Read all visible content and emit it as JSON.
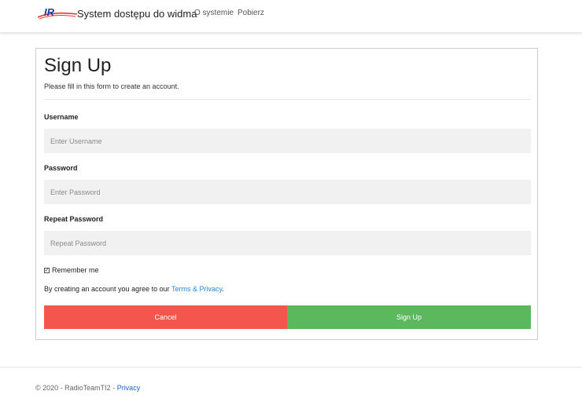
{
  "header": {
    "logo_text": "IR",
    "brand": "System dostępu do widma",
    "nav": [
      {
        "label": "O systemie"
      },
      {
        "label": "Pobierz"
      }
    ]
  },
  "form": {
    "title": "Sign Up",
    "subtitle": "Please fill in this form to create an account.",
    "username": {
      "label": "Username",
      "placeholder": "Enter Username",
      "value": ""
    },
    "password": {
      "label": "Password",
      "placeholder": "Enter Password",
      "value": ""
    },
    "repeat_password": {
      "label": "Repeat Password",
      "placeholder": "Repeat Password",
      "value": ""
    },
    "remember": {
      "label": "Remember me",
      "checked": true
    },
    "terms_prefix": "By creating an account you agree to our ",
    "terms_link": "Terms & Privacy",
    "terms_suffix": ".",
    "cancel_label": "Cancel",
    "signup_label": "Sign Up"
  },
  "footer": {
    "text": "© 2020 - RadioTeamTI2 - ",
    "privacy_link": "Privacy"
  },
  "colors": {
    "cancel": "#f4554c",
    "signup": "#5cb85c",
    "link": "#1e88e5",
    "logo_blue": "#1a3a9c",
    "logo_red": "#e53935"
  }
}
